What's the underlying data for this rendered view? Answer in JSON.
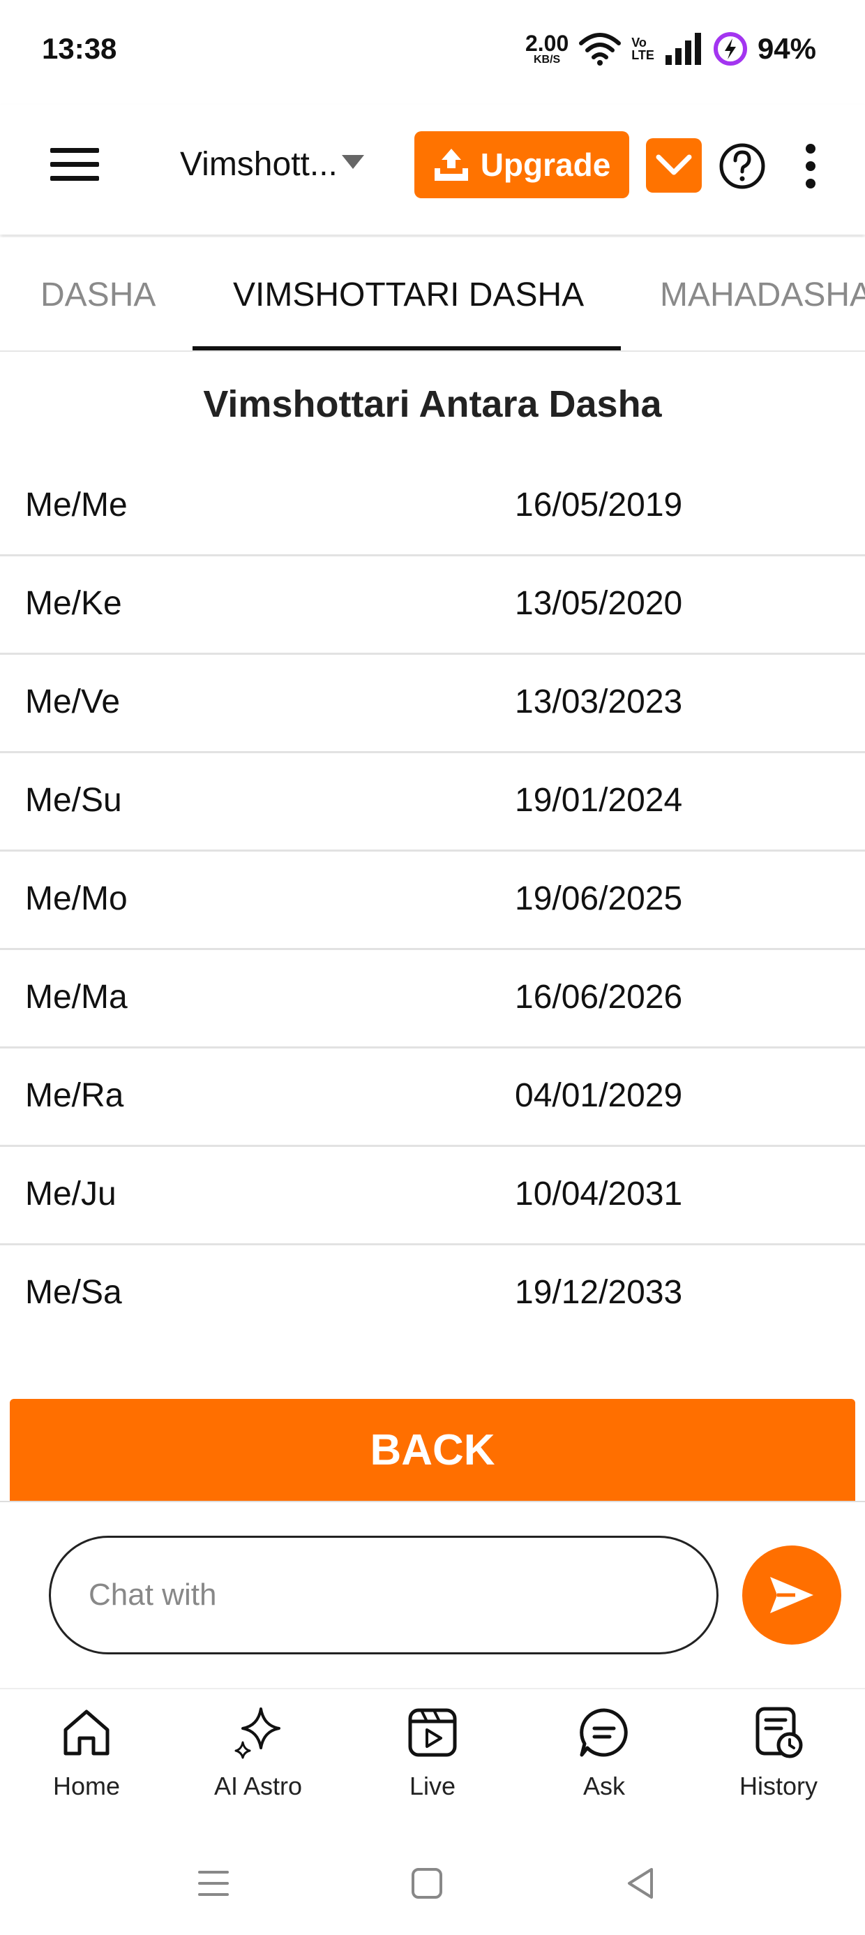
{
  "status_bar": {
    "time": "13:38",
    "net_speed_value": "2.00",
    "net_speed_unit": "KB/S",
    "volte_top": "Vo",
    "volte_bottom": "LTE",
    "battery": "94%"
  },
  "app_bar": {
    "title": "Vimshott...",
    "upgrade_label": "Upgrade",
    "accent_color": "#ff7300"
  },
  "tabs": [
    {
      "label": "DASHA",
      "active": false
    },
    {
      "label": "VIMSHOTTARI DASHA",
      "active": true
    },
    {
      "label": "MAHADASHA",
      "active": false
    }
  ],
  "section": {
    "title": "Vimshottari Antara Dasha"
  },
  "dasha_rows": [
    {
      "planet": "Me/Me",
      "date": "16/05/2019"
    },
    {
      "planet": "Me/Ke",
      "date": "13/05/2020"
    },
    {
      "planet": "Me/Ve",
      "date": "13/03/2023"
    },
    {
      "planet": "Me/Su",
      "date": "19/01/2024"
    },
    {
      "planet": "Me/Mo",
      "date": "19/06/2025"
    },
    {
      "planet": "Me/Ma",
      "date": "16/06/2026"
    },
    {
      "planet": "Me/Ra",
      "date": "04/01/2029"
    },
    {
      "planet": "Me/Ju",
      "date": "10/04/2031"
    },
    {
      "planet": "Me/Sa",
      "date": "19/12/2033"
    }
  ],
  "back_button": {
    "label": "BACK"
  },
  "chat": {
    "placeholder": "Chat with"
  },
  "bottom_nav": [
    {
      "label": "Home",
      "icon": "home-icon"
    },
    {
      "label": "AI Astro",
      "icon": "sparkle-icon"
    },
    {
      "label": "Live",
      "icon": "live-video-icon"
    },
    {
      "label": "Ask",
      "icon": "chat-bubble-icon"
    },
    {
      "label": "History",
      "icon": "history-icon"
    }
  ]
}
